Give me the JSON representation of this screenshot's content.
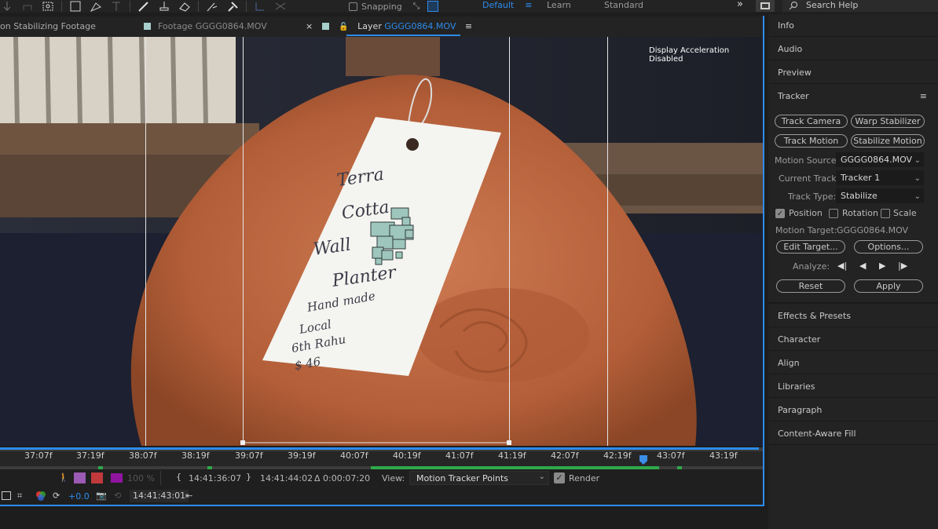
{
  "toolbar": {
    "snapping": "Snapping",
    "workspaces": [
      "Default",
      "Learn",
      "Standard"
    ],
    "more": "»",
    "search_placeholder": "Search Help"
  },
  "tabs": {
    "comp": "on Stabilizing Footage",
    "footage_prefix": "Footage",
    "footage_name": "GGGG0864.MOV",
    "layer_prefix": "Layer",
    "layer_name": "GGGG0864.MOV",
    "close": "×"
  },
  "viewer": {
    "notice": "Display Acceleration Disabled",
    "tag_text": [
      "Terra",
      "Cotta",
      "Wall",
      "Planter",
      "Hand made",
      "Local",
      "6th Rahu",
      "$ 46"
    ]
  },
  "timeline": {
    "ticks": [
      "37:07f",
      "37:19f",
      "38:07f",
      "38:19f",
      "39:07f",
      "39:19f",
      "40:07f",
      "40:19f",
      "41:07f",
      "41:19f",
      "42:07f",
      "42:19f",
      "43:07f",
      "43:19f"
    ]
  },
  "controls": {
    "zoom": "100 %",
    "in_time": "14:41:36:07",
    "out_time": "14:41:44:02",
    "duration": "Δ 0:00:07:20",
    "view_label": "View:",
    "view_value": "Motion Tracker Points",
    "render_label": "Render",
    "exposure": "+0.0",
    "current_time": "14:41:43:01"
  },
  "panels": {
    "info": "Info",
    "audio": "Audio",
    "preview": "Preview",
    "tracker": "Tracker",
    "effects": "Effects & Presets",
    "character": "Character",
    "align": "Align",
    "libraries": "Libraries",
    "paragraph": "Paragraph",
    "caf": "Content-Aware Fill"
  },
  "tracker": {
    "track_camera": "Track Camera",
    "warp_stabilizer": "Warp Stabilizer",
    "track_motion": "Track Motion",
    "stabilize_motion": "Stabilize Motion",
    "motion_source_label": "Motion Source:",
    "motion_source": "GGGG0864.MOV",
    "current_track_label": "Current Track:",
    "current_track": "Tracker 1",
    "track_type_label": "Track Type:",
    "track_type": "Stabilize",
    "position": "Position",
    "rotation": "Rotation",
    "scale": "Scale",
    "position_checked": true,
    "motion_target_label": "Motion Target:",
    "motion_target": "GGGG0864.MOV",
    "edit_target": "Edit Target...",
    "options": "Options...",
    "analyze_label": "Analyze:",
    "reset": "Reset",
    "apply": "Apply"
  },
  "colors": {
    "accent": "#2d8ceb",
    "panel": "#232323",
    "clay": "#b8623a",
    "work_area": "#2fa84a"
  }
}
